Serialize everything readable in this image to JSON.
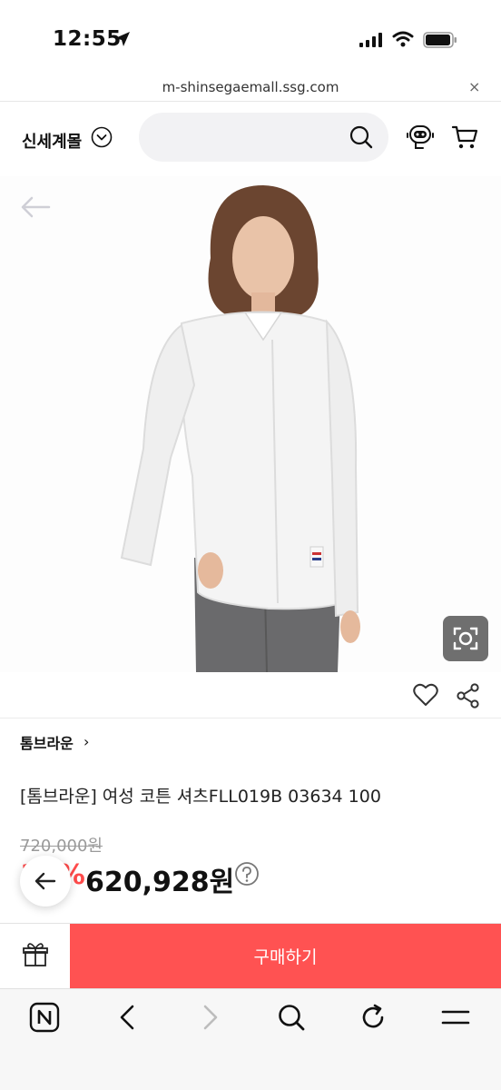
{
  "status_bar": {
    "time": "12:55"
  },
  "url_bar": {
    "url": "m-shinsegaemall.ssg.com",
    "close": "×"
  },
  "header": {
    "brand": "신세계몰"
  },
  "product": {
    "brand": "톰브라운",
    "brand_chevron": "›",
    "name": "[톰브라운] 여성 코튼 셔츠FLL019B 03634 100",
    "original_price": "720,000원",
    "discount_rate": "13%",
    "sale_price": "620,928원"
  },
  "bottom_bar": {
    "buy_label": "구매하기"
  },
  "colors": {
    "accent": "#ff5252",
    "discount": "#ff4b4b"
  }
}
